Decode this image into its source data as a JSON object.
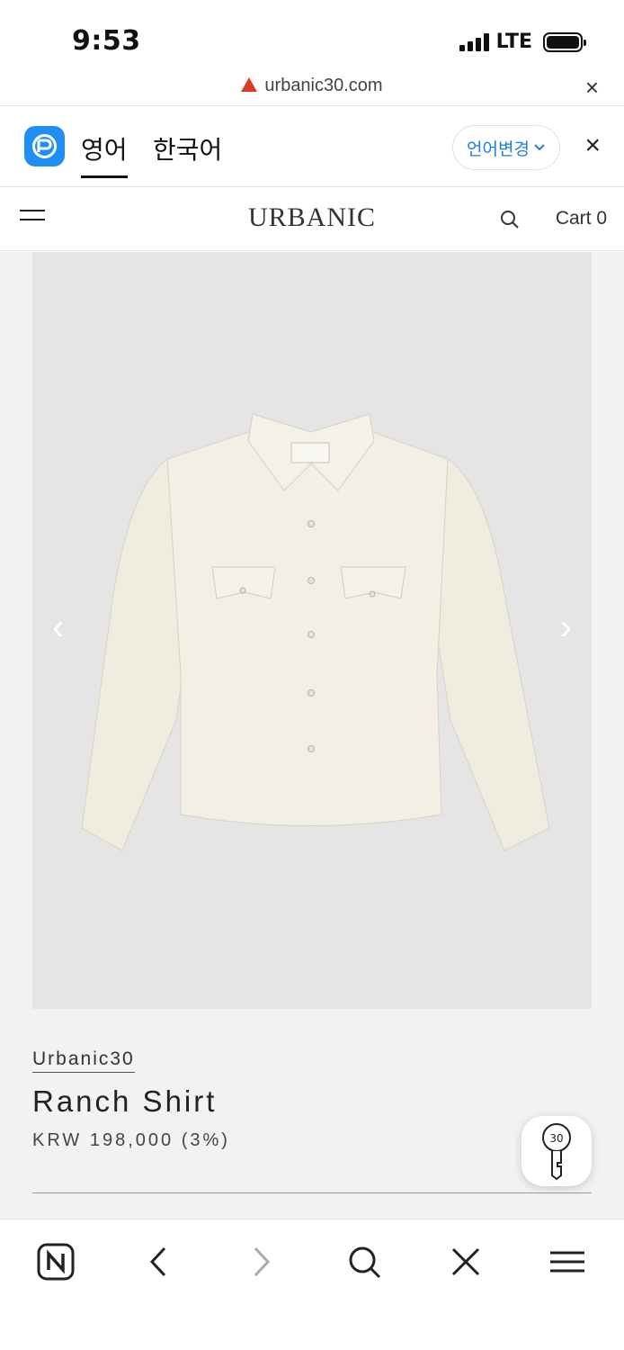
{
  "status_bar": {
    "time": "9:53",
    "network": "LTE"
  },
  "url_bar": {
    "url": "urbanic30.com",
    "close": "×"
  },
  "translate_bar": {
    "tab_source": "영어",
    "tab_target": "한국어",
    "change_language": "언어변경",
    "close": "×"
  },
  "site_header": {
    "logo": "URBANIC",
    "cart": "Cart 0"
  },
  "product": {
    "image_alt": "Ranch Shirt - cream long sleeve western shirt",
    "prev": "‹",
    "next": "›",
    "brand": "Urbanic30",
    "name": "Ranch Shirt",
    "price": "KRW 198,000 (3%)",
    "key_badge": "30"
  },
  "toolbar": {
    "items": [
      "N",
      "back",
      "forward",
      "search",
      "close",
      "menu"
    ]
  }
}
